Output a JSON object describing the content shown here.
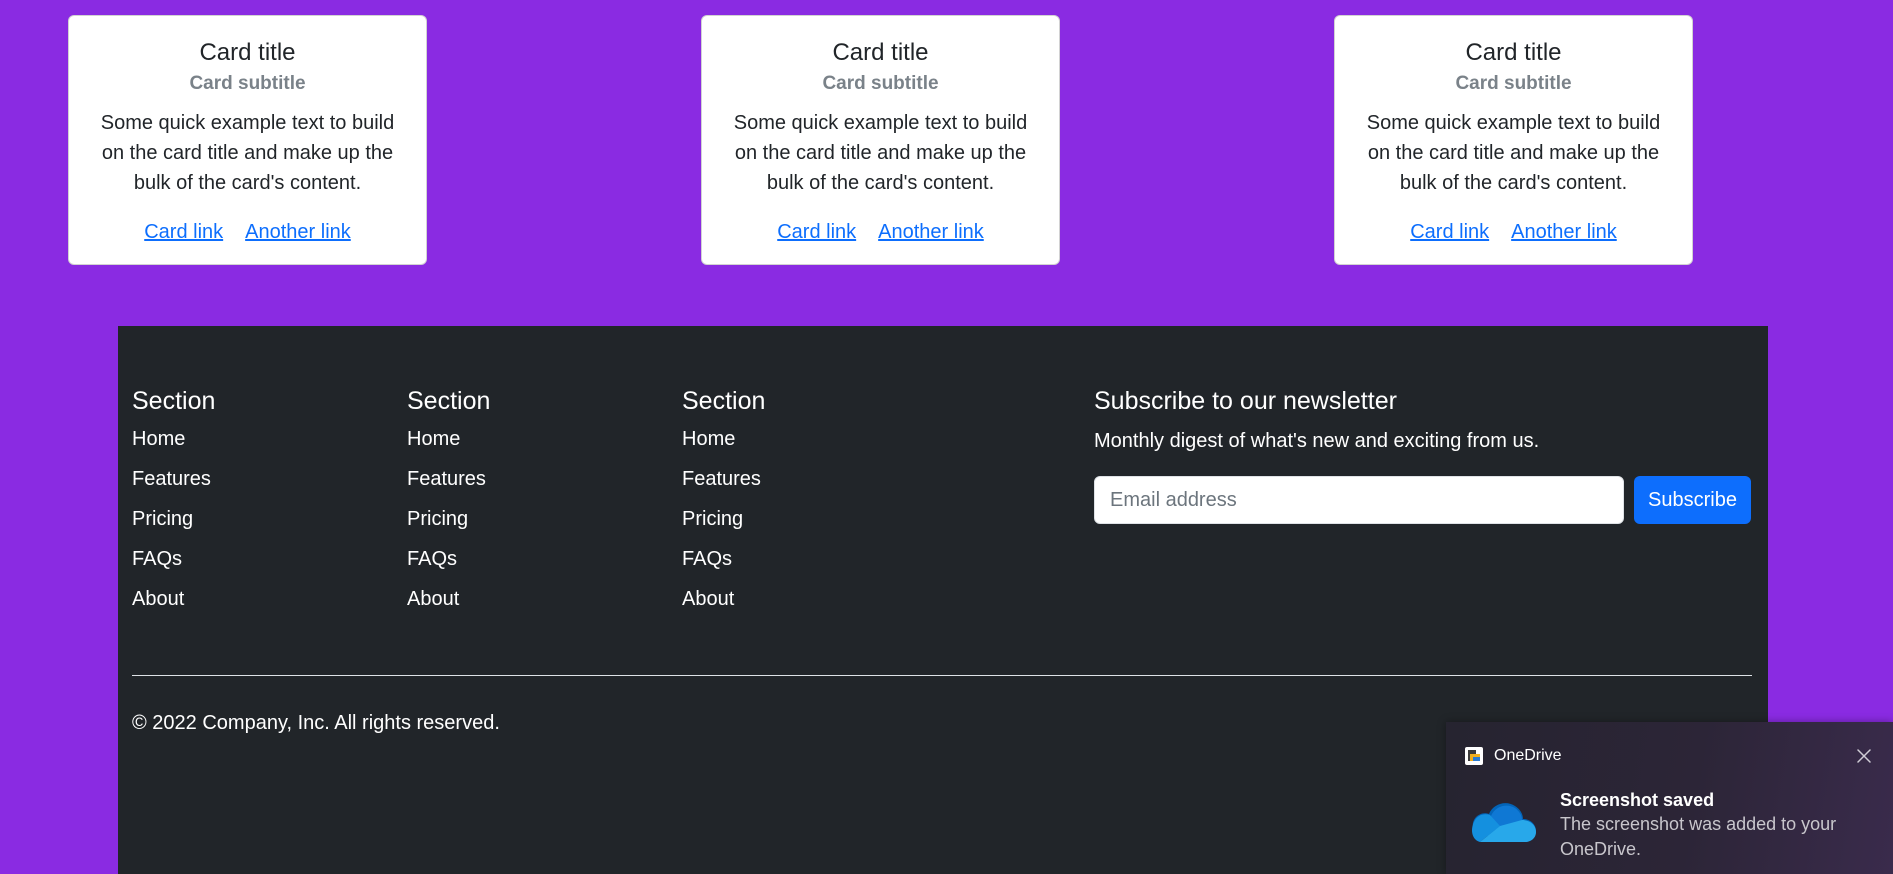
{
  "cards": [
    {
      "title": "Card title",
      "subtitle": "Card subtitle",
      "text": "Some quick example text to build on the card title and make up the bulk of the card's content.",
      "link1": "Card link",
      "link2": "Another link"
    },
    {
      "title": "Card title",
      "subtitle": "Card subtitle",
      "text": "Some quick example text to build on the card title and make up the bulk of the card's content.",
      "link1": "Card link",
      "link2": "Another link"
    },
    {
      "title": "Card title",
      "subtitle": "Card subtitle",
      "text": "Some quick example text to build on the card title and make up the bulk of the card's content.",
      "link1": "Card link",
      "link2": "Another link"
    }
  ],
  "footer": {
    "sections": [
      {
        "heading": "Section",
        "links": [
          "Home",
          "Features",
          "Pricing",
          "FAQs",
          "About"
        ]
      },
      {
        "heading": "Section",
        "links": [
          "Home",
          "Features",
          "Pricing",
          "FAQs",
          "About"
        ]
      },
      {
        "heading": "Section",
        "links": [
          "Home",
          "Features",
          "Pricing",
          "FAQs",
          "About"
        ]
      }
    ],
    "newsletter": {
      "heading": "Subscribe to our newsletter",
      "description": "Monthly digest of what's new and exciting from us.",
      "email_placeholder": "Email address",
      "email_value": "",
      "subscribe_label": "Subscribe"
    },
    "copyright": "© 2022 Company, Inc. All rights reserved."
  },
  "toast": {
    "app_name": "OneDrive",
    "title": "Screenshot saved",
    "body": "The screenshot was added to your OneDrive.",
    "app_icon": "onedrive-app-icon",
    "cloud_icon": "onedrive-cloud-icon",
    "close_icon": "close-icon"
  },
  "colors": {
    "page_background": "#8a2be2",
    "footer_background": "#212529",
    "link": "#0d6efd",
    "button": "#0d6efd",
    "toast_background": "#2c2537"
  }
}
